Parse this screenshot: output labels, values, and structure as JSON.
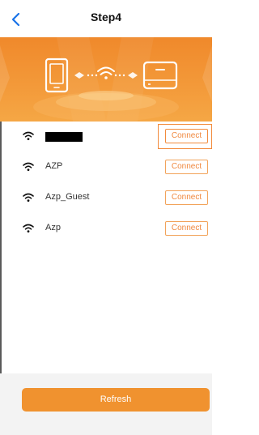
{
  "header": {
    "title": "Step4",
    "back_icon": "chevron-left-icon"
  },
  "banner": {
    "left_device_icon": "phone-icon",
    "center_icon": "wifi-icon",
    "right_device_icon": "router-icon",
    "colors": {
      "bg": "#f39a3a",
      "accent": "#ffffff"
    }
  },
  "networks": [
    {
      "ssid": "",
      "redacted": true,
      "button": "Connect",
      "focused": true
    },
    {
      "ssid": "AZP",
      "redacted": false,
      "button": "Connect",
      "focused": false
    },
    {
      "ssid": "Azp_Guest",
      "redacted": false,
      "button": "Connect",
      "focused": false
    },
    {
      "ssid": "Azp",
      "redacted": false,
      "button": "Connect",
      "focused": false
    }
  ],
  "footer": {
    "refresh_label": "Refresh"
  },
  "colors": {
    "brand": "#f0922f",
    "link": "#1a73e8"
  }
}
